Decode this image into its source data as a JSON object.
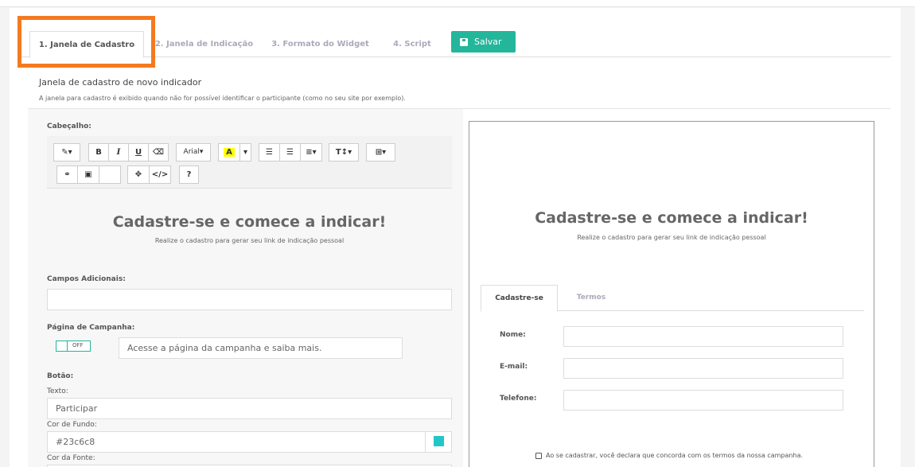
{
  "tabs": [
    {
      "label": "1. Janela de Cadastro",
      "active": true
    },
    {
      "label": "2. Janela de Indicação",
      "active": false
    },
    {
      "label": "3. Formato do Widget",
      "active": false
    },
    {
      "label": "4. Script",
      "active": false
    }
  ],
  "save_button": {
    "label": "Salvar",
    "icon": "floppy-disk-icon"
  },
  "section": {
    "title": "Janela de cadastro de novo indicador",
    "description": "A janela para cadastro é exibido quando não for possível identificar o participante (como no seu site por exemplo)."
  },
  "form": {
    "header_label": "Cabeçalho:",
    "toolbar": {
      "font_name": "Arial",
      "font_color_glyph": "A",
      "bold": "B",
      "italic": "I",
      "underline": "U",
      "help": "?",
      "text_size": "T↕"
    },
    "editor": {
      "headline": "Cadastre-se e comece a indicar!",
      "subline": "Realize o cadastro para gerar seu link de indicação pessoal"
    },
    "extra_fields_label": "Campos Adicionais:",
    "extra_fields_value": "",
    "campaign_page_label": "Página de Campanha:",
    "campaign_toggle": "OFF",
    "campaign_text": "Acesse a página da campanha e saiba mais.",
    "button_label": "Botão:",
    "text_label": "Texto:",
    "text_value": "Participar",
    "bg_color_label": "Cor de Fundo:",
    "bg_color_value": "#23c6c8",
    "font_color_label": "Cor da Fonte:"
  },
  "preview": {
    "headline": "Cadastre-se e comece a indicar!",
    "subline": "Realize o cadastro para gerar seu link de indicação pessoal",
    "tabs": [
      {
        "label": "Cadastre-se",
        "active": true
      },
      {
        "label": "Termos",
        "active": false
      }
    ],
    "fields": [
      {
        "label": "Nome:"
      },
      {
        "label": "E-mail:"
      },
      {
        "label": "Telefone:"
      }
    ],
    "terms_text": "Ao se cadastrar, você declara que concorda com os termos da nossa campanha."
  },
  "colors": {
    "accent": "#23b69b",
    "swatch": "#23c6c8",
    "highlight": "#f47a20"
  }
}
